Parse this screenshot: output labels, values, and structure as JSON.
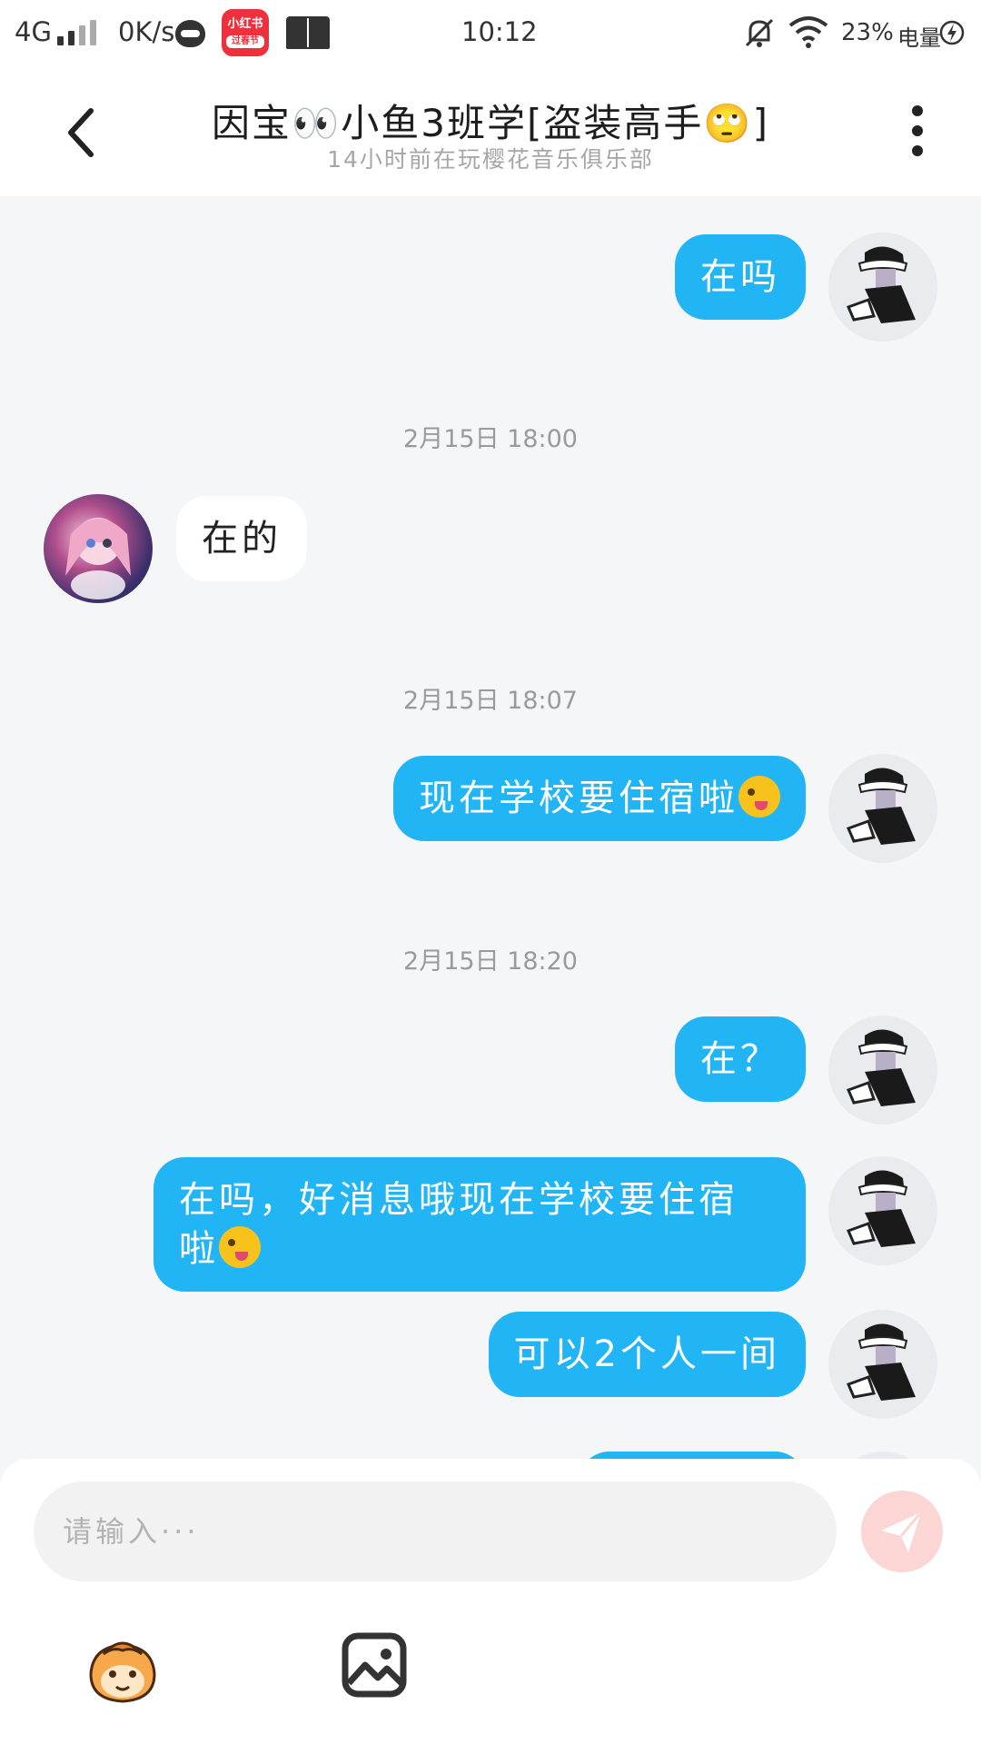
{
  "status_bar": {
    "network": "4G",
    "speed": "0K/s",
    "red_app_line1": "小红书",
    "red_app_line2": "过春节",
    "time": "10:12",
    "battery": "23%",
    "battery_label": "电量"
  },
  "header": {
    "title": "因宝👀小鱼3班学[盗装高手🙄]",
    "subtitle": "14小时前在玩樱花音乐俱乐部"
  },
  "messages": [
    {
      "side": "out",
      "text": "在吗"
    },
    {
      "timestamp": "2月15日 18:00"
    },
    {
      "side": "in",
      "text": "在的"
    },
    {
      "timestamp": "2月15日 18:07"
    },
    {
      "side": "out",
      "text": "现在学校要住宿啦",
      "emoji": "winking-tongue"
    },
    {
      "timestamp": "2月15日 18:20"
    },
    {
      "side": "out",
      "text": "在？"
    },
    {
      "side": "out",
      "text": "在吗，好消息哦现在学校要住宿",
      "text2": "啦",
      "emoji": "winking-tongue"
    },
    {
      "side": "out",
      "text": "可以2个人一间"
    }
  ],
  "input": {
    "placeholder": "请输入···"
  },
  "colors": {
    "outgoing_bubble": "#21b5f5",
    "incoming_bubble": "#ffffff",
    "background": "#f4f6f8",
    "send_button": "#fcd6d4"
  },
  "icons": [
    "back-arrow-icon",
    "more-vertical-icon",
    "send-icon",
    "sticker-icon",
    "image-icon"
  ]
}
